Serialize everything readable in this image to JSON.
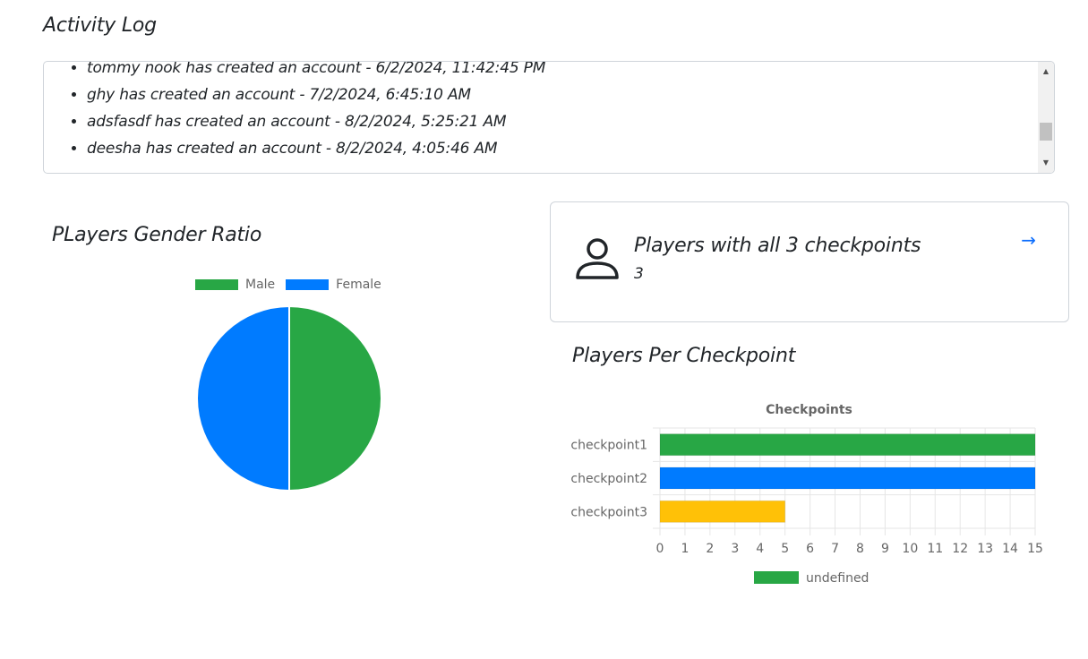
{
  "activity": {
    "title": "Activity Log",
    "entries": [
      "tommy nook has created an account - 6/2/2024, 11:42:45 PM",
      "ghy has created an account - 7/2/2024, 6:45:10 AM",
      "adsfasdf has created an account - 8/2/2024, 5:25:21 AM",
      "deesha has created an account - 8/2/2024, 4:05:46 AM"
    ]
  },
  "gender": {
    "title": "PLayers Gender Ratio",
    "legend": [
      {
        "label": "Male",
        "color": "#28a745"
      },
      {
        "label": "Female",
        "color": "#007bff"
      }
    ]
  },
  "stat_card": {
    "label": "Players with all 3 checkpoints",
    "value": "3",
    "icon": "user-icon",
    "arrow": "→"
  },
  "checkpoints": {
    "title": "Players Per Checkpoint"
  },
  "chart_data": [
    {
      "type": "pie",
      "categories": [
        "Male",
        "Female"
      ],
      "values": [
        1,
        1
      ],
      "colors": [
        "#28a745",
        "#007bff"
      ],
      "legend": "top"
    },
    {
      "type": "bar",
      "orientation": "horizontal",
      "title": "Checkpoints",
      "categories": [
        "checkpoint1",
        "checkpoint2",
        "checkpoint3"
      ],
      "series": [
        {
          "name": "undefined",
          "values": [
            15,
            15,
            5
          ]
        }
      ],
      "colors": [
        "#28a745",
        "#007bff",
        "#ffc107"
      ],
      "xlim": [
        0,
        15
      ],
      "xticks": [
        "0",
        "1",
        "2",
        "3",
        "4",
        "5",
        "6",
        "7",
        "8",
        "9",
        "10",
        "11",
        "12",
        "13",
        "14",
        "15"
      ],
      "grid": true,
      "legend": "bottom"
    }
  ]
}
